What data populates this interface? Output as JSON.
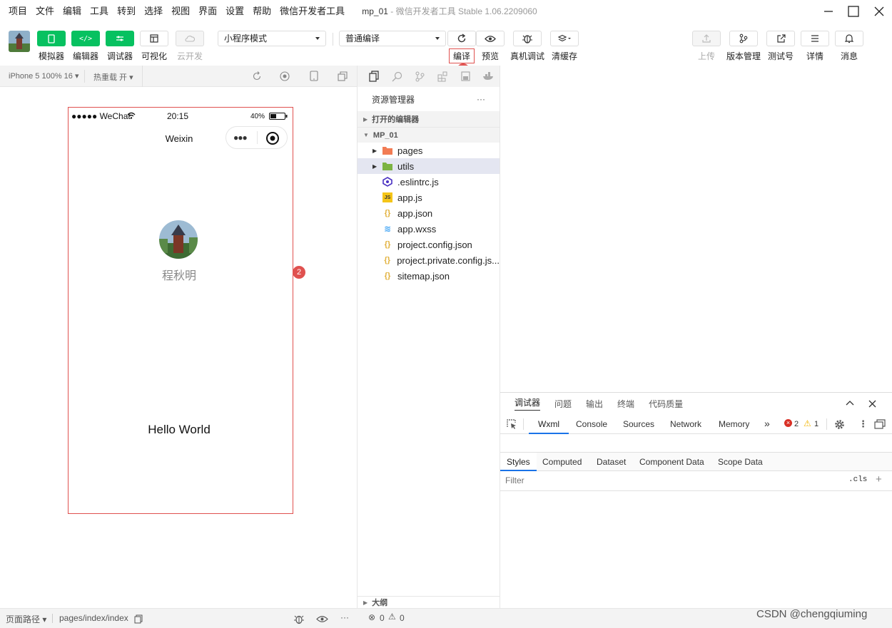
{
  "menu": [
    "项目",
    "文件",
    "编辑",
    "工具",
    "转到",
    "选择",
    "视图",
    "界面",
    "设置",
    "帮助",
    "微信开发者工具"
  ],
  "window": {
    "title_project": "mp_01",
    "title_rest": "- 微信开发者工具 Stable 1.06.2209060"
  },
  "toolbar": {
    "simulator": "模拟器",
    "editor": "编辑器",
    "debugger": "调试器",
    "visual": "可视化",
    "cloud": "云开发",
    "mode_select": "小程序模式",
    "compile_select": "普通编译",
    "compile": "编译",
    "preview": "预览",
    "remote_debug": "真机调试",
    "clear_cache": "清缓存",
    "upload": "上传",
    "version": "版本管理",
    "test_account": "测试号",
    "details": "详情",
    "messages": "消息"
  },
  "annotations": {
    "badge1": "1",
    "badge2": "2"
  },
  "sim": {
    "device": "iPhone 5 100% 16",
    "hot_reload": "热重载 开"
  },
  "phone": {
    "signal": "●●●●● WeChat",
    "time": "20:15",
    "battery": "40%",
    "nav_title": "Weixin",
    "nickname": "程秋明",
    "hello": "Hello World"
  },
  "explorer": {
    "title": "资源管理器",
    "more": "···",
    "open_editors": "打开的编辑器",
    "project": "MP_01",
    "items": [
      {
        "name": "pages",
        "type": "folder"
      },
      {
        "name": "utils",
        "type": "folder"
      },
      {
        "name": ".eslintrc.js",
        "type": "eslint"
      },
      {
        "name": "app.js",
        "type": "js"
      },
      {
        "name": "app.json",
        "type": "json"
      },
      {
        "name": "app.wxss",
        "type": "css"
      },
      {
        "name": "project.config.json",
        "type": "json"
      },
      {
        "name": "project.private.config.js...",
        "type": "json"
      },
      {
        "name": "sitemap.json",
        "type": "json"
      }
    ],
    "outline": "大纲"
  },
  "debug": {
    "tabs": [
      "调试器",
      "问题",
      "输出",
      "终端",
      "代码质量"
    ],
    "devtabs": [
      "Wxml",
      "Console",
      "Sources",
      "Network",
      "Memory"
    ],
    "errors": "2",
    "warnings": "1",
    "style_tabs": [
      "Styles",
      "Computed",
      "Dataset",
      "Component Data",
      "Scope Data"
    ],
    "filter_placeholder": "Filter",
    "cls": ".cls"
  },
  "status": {
    "path_label": "页面路径",
    "path": "pages/index/index",
    "problems_errors": "0",
    "problems_warnings": "0"
  },
  "watermark": "CSDN @chengqiuming",
  "colors": {
    "green": "#07c160",
    "annotation_red": "#e0514f"
  }
}
